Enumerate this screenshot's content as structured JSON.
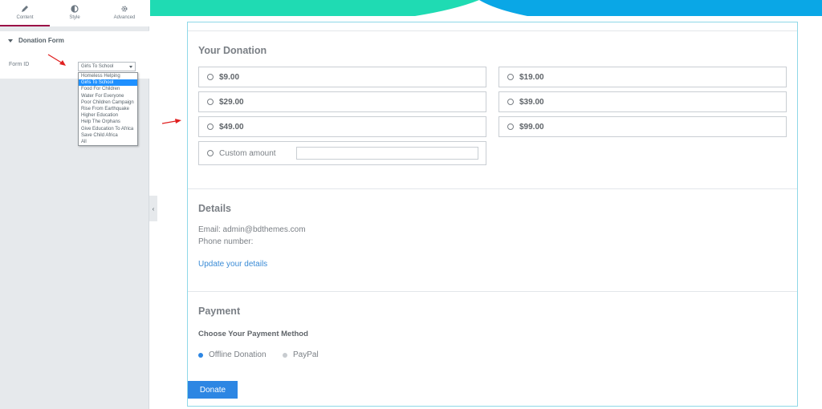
{
  "panel": {
    "tabs": [
      {
        "label": "Content",
        "icon": "pencil-icon"
      },
      {
        "label": "Style",
        "icon": "half-circle-icon"
      },
      {
        "label": "Advanced",
        "icon": "gear-icon"
      }
    ],
    "section_title": "Donation Form",
    "field_label": "Form ID",
    "selected_value": "Girls To School",
    "options": [
      "Homeless Helping",
      "Girls To School",
      "Food For Children",
      "Water For Everyone",
      "Poor Children Campaign",
      "Rise From Earthquake",
      "Higher Education",
      "Help The Orphans",
      "Give Education To Africa",
      "Save Child Africa",
      "All"
    ],
    "collapse_glyph": "‹"
  },
  "form": {
    "donation_title": "Your Donation",
    "amounts": [
      "$9.00",
      "$19.00",
      "$29.00",
      "$39.00",
      "$49.00",
      "$99.00"
    ],
    "custom_label": "Custom amount",
    "details_title": "Details",
    "email_line": "Email: admin@bdthemes.com",
    "phone_line": "Phone number:",
    "update_link": "Update your details",
    "payment_title": "Payment",
    "payment_subtitle": "Choose Your Payment Method",
    "payment_options": [
      "Offline Donation",
      "PayPal"
    ],
    "selected_payment": "Offline Donation",
    "donate_label": "Donate"
  },
  "colors": {
    "accent_tab": "#9b0a46",
    "banner_teal": "#1fdbb3",
    "banner_blue": "#0aa7e6",
    "link": "#3a8bd6",
    "button": "#2d86e3",
    "annotation_arrow": "#e02020"
  }
}
